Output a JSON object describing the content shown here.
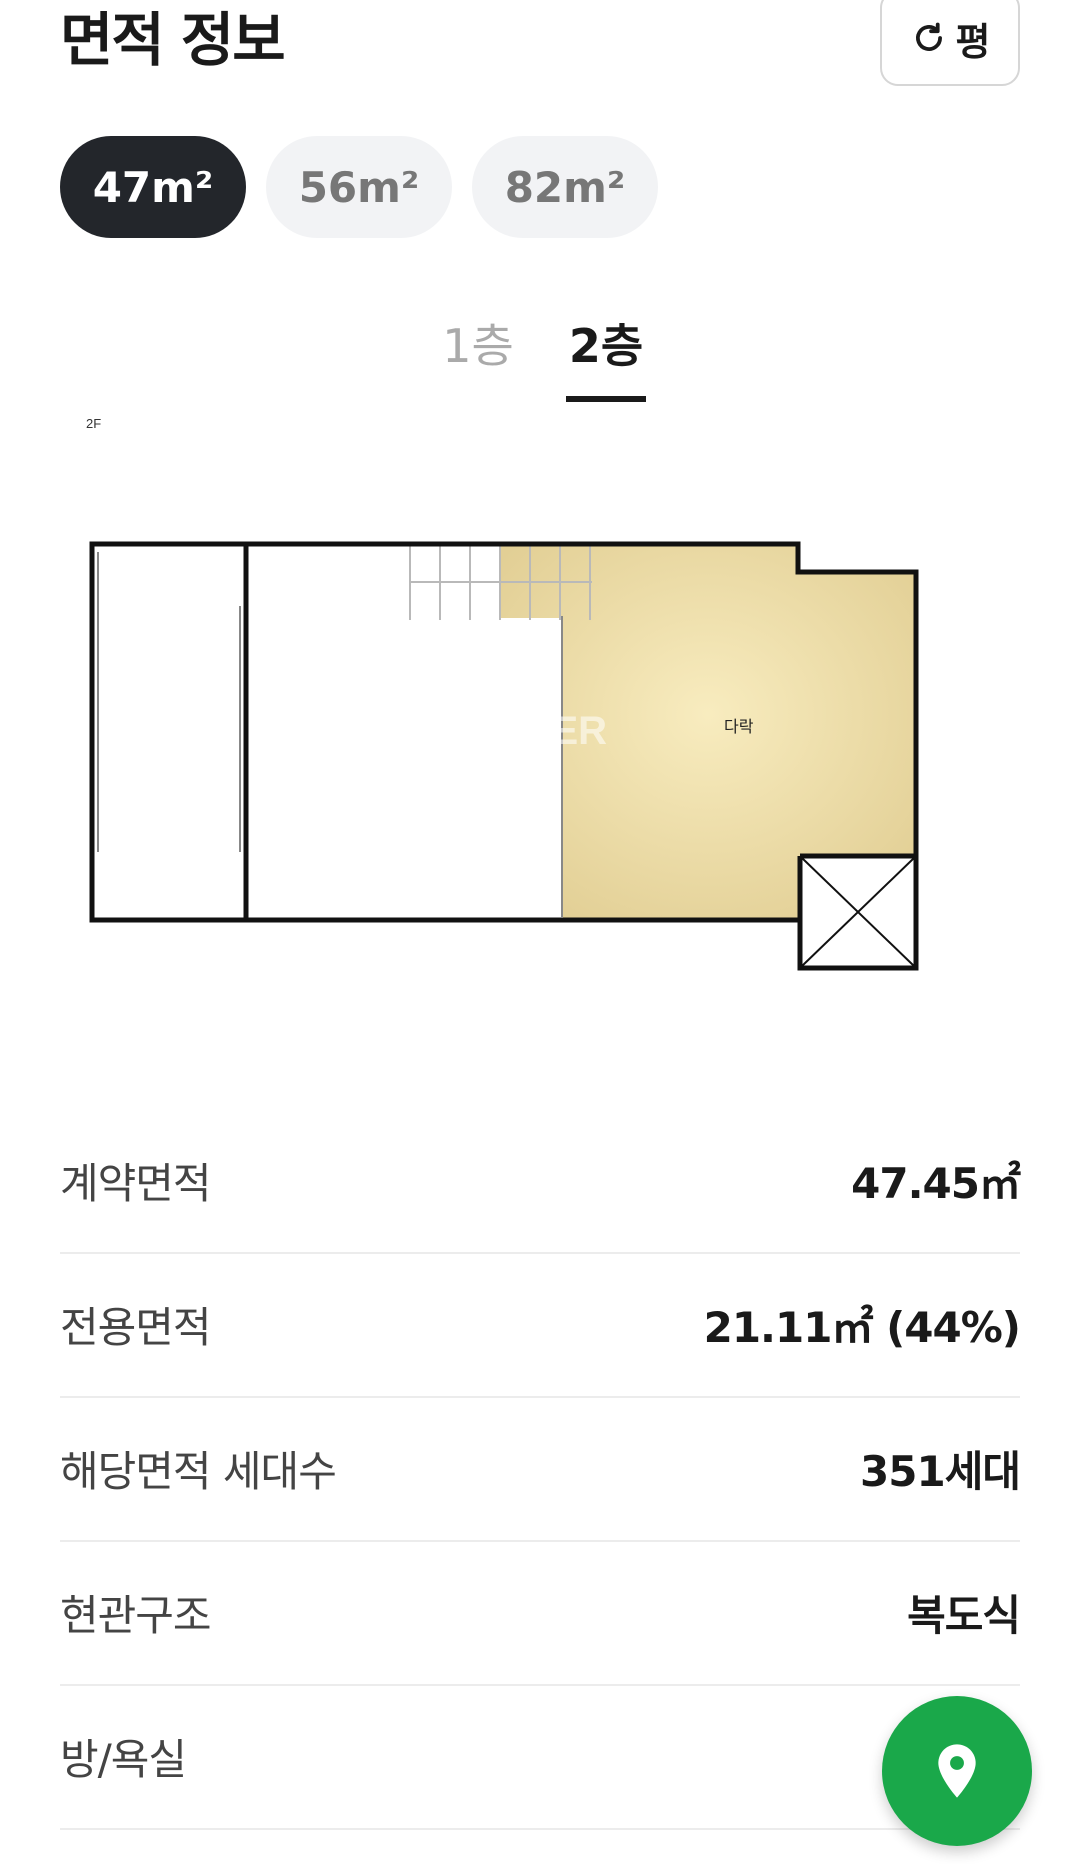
{
  "header": {
    "title": "면적 정보",
    "unit_toggle_label": "평"
  },
  "area_chips": [
    {
      "label": "47m²",
      "active": true
    },
    {
      "label": "56m²",
      "active": false
    },
    {
      "label": "82m²",
      "active": false
    }
  ],
  "floor_tabs": [
    {
      "label": "1층",
      "active": false
    },
    {
      "label": "2층",
      "active": true
    }
  ],
  "floorplan": {
    "floor_label": "2F",
    "room_label": "다락",
    "watermark": "NAVER"
  },
  "info": [
    {
      "label": "계약면적",
      "value": "47.45㎡"
    },
    {
      "label": "전용면적",
      "value": "21.11㎡ (44%)"
    },
    {
      "label": "해당면적 세대수",
      "value": "351세대"
    },
    {
      "label": "현관구조",
      "value": "복도식"
    },
    {
      "label": "방/욕실",
      "value": ""
    }
  ],
  "icons": {
    "refresh": "refresh-icon",
    "location": "location-pin-icon"
  },
  "colors": {
    "chip_active_bg": "#23262b",
    "chip_inactive_bg": "#f2f3f5",
    "fab_green": "#1aa84a",
    "attic_fill": "#f3e3a8"
  }
}
